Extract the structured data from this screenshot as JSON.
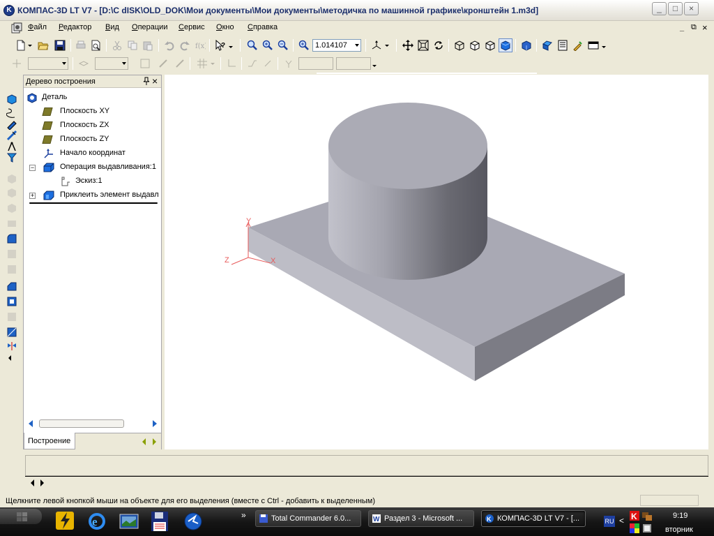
{
  "window": {
    "title": "КОМПАС-3D LT V7 - [D:\\C dISK\\OLD_DOK\\Мои документы\\Мои документы\\методичка по машинной графике\\кронштейн 1.m3d]",
    "controls": {
      "minimize": "_",
      "restore": "□",
      "close": "×"
    },
    "child_controls": {
      "minimize": "_",
      "restore": "⧉",
      "close": "×"
    }
  },
  "menu": {
    "items": [
      {
        "first": "Ф",
        "rest": "айл"
      },
      {
        "first": "Р",
        "rest": "едактор"
      },
      {
        "first": "В",
        "rest": "ид"
      },
      {
        "first": "О",
        "rest": "перации"
      },
      {
        "first": "С",
        "rest": "ервис"
      },
      {
        "first": "О",
        "rest": "кно"
      },
      {
        "first": "С",
        "rest": "правка"
      }
    ]
  },
  "toolbar": {
    "zoom_value": "1.014107"
  },
  "tree": {
    "header": "Дерево построения",
    "pin_icon": "pin-icon",
    "close": "×",
    "nodes": [
      {
        "label": "Деталь",
        "icon": "part-icon"
      },
      {
        "label": "Плоскость XY",
        "icon": "plane-icon"
      },
      {
        "label": "Плоскость ZX",
        "icon": "plane-icon"
      },
      {
        "label": "Плоскость ZY",
        "icon": "plane-icon"
      },
      {
        "label": "Начало координат",
        "icon": "origin-icon"
      },
      {
        "label": "Операция выдавливания:1",
        "icon": "extrude-icon",
        "expander": "−"
      },
      {
        "label": "Эскиз:1",
        "icon": "sketch-icon"
      },
      {
        "label": "Приклеить элемент выдавл",
        "icon": "boss-icon",
        "expander": "+"
      }
    ],
    "tab_label": "Построение"
  },
  "viewport": {
    "axes": {
      "x": "X",
      "y": "Y",
      "z": "Z"
    },
    "model_color": "#a9a9b4"
  },
  "status": {
    "message": "Щелкните левой кнопкой мыши на объекте для его выделения (вместе с Ctrl - добавить к выделенным)"
  },
  "taskbar": {
    "tasks": [
      {
        "label": "Total Commander 6.0...",
        "icon": "floppy-icon"
      },
      {
        "label": "Раздел 3 - Microsoft ...",
        "icon": "word-icon"
      },
      {
        "label": "КОМПАС-3D LT V7 - [...",
        "icon": "kompas-icon",
        "active": true
      }
    ],
    "overflow": "»",
    "lang": "RU",
    "tray_arrow": "<",
    "time": "9:19",
    "day": "вторник"
  }
}
